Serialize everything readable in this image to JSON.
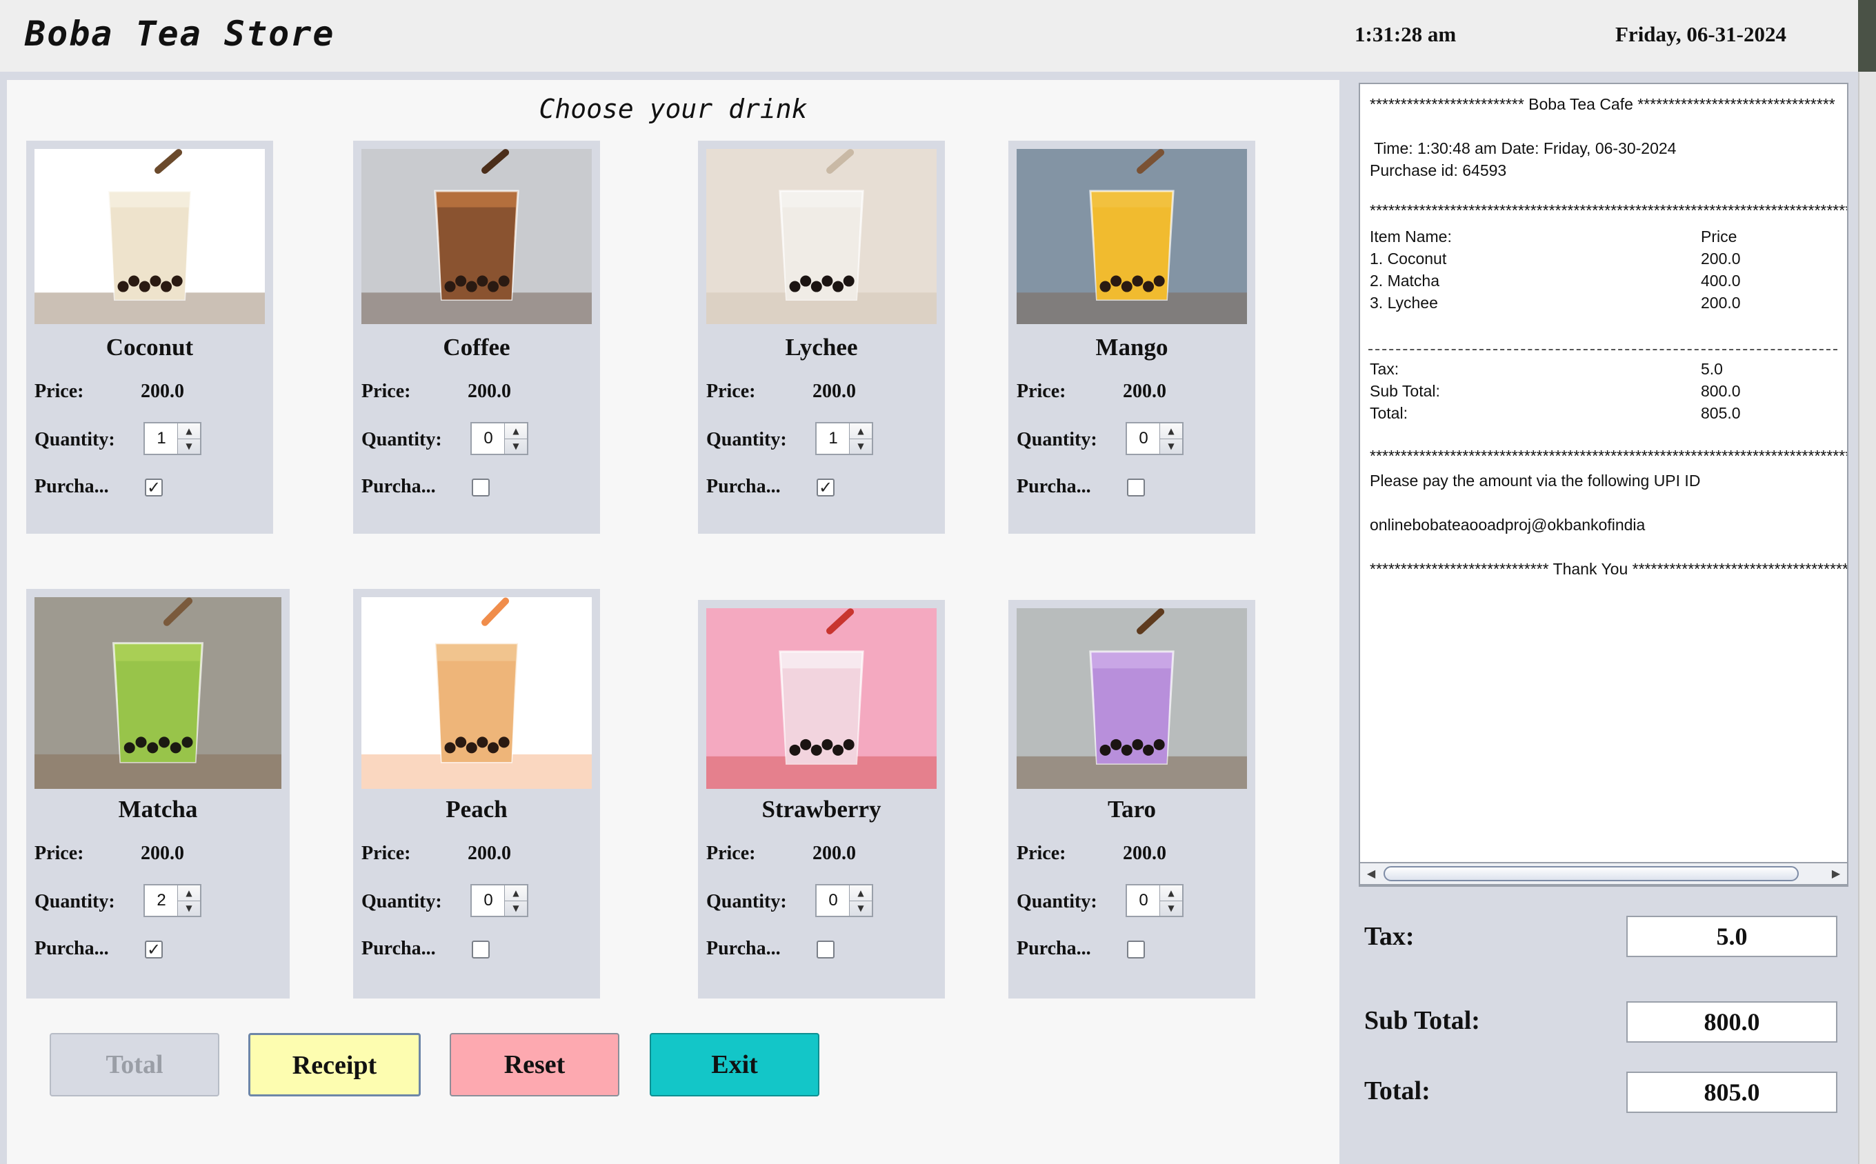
{
  "header": {
    "title": "Boba Tea Store",
    "time": "1:31:28 am",
    "date": "Friday, 06-31-2024"
  },
  "main": {
    "heading": "Choose your drink",
    "labels": {
      "price": "Price:",
      "quantity": "Quantity:",
      "purchase": "Purcha..."
    },
    "drinks": [
      {
        "name": "Coconut",
        "price": "200.0",
        "quantity": "1",
        "purchased": true,
        "photo": "coconut-bubble-tea"
      },
      {
        "name": "Coffee",
        "price": "200.0",
        "quantity": "0",
        "purchased": false,
        "photo": "coffee-bubble-tea"
      },
      {
        "name": "Lychee",
        "price": "200.0",
        "quantity": "1",
        "purchased": true,
        "photo": "lychee-bubble-tea"
      },
      {
        "name": "Mango",
        "price": "200.0",
        "quantity": "0",
        "purchased": false,
        "photo": "mango-bubble-tea"
      },
      {
        "name": "Matcha",
        "price": "200.0",
        "quantity": "2",
        "purchased": true,
        "photo": "matcha-bubble-tea"
      },
      {
        "name": "Peach",
        "price": "200.0",
        "quantity": "0",
        "purchased": false,
        "photo": "peach-bubble-tea"
      },
      {
        "name": "Strawberry",
        "price": "200.0",
        "quantity": "0",
        "purchased": false,
        "photo": "strawberry-bubble-tea"
      },
      {
        "name": "Taro",
        "price": "200.0",
        "quantity": "0",
        "purchased": false,
        "photo": "taro-bubble-tea"
      }
    ],
    "buttons": {
      "total": "Total",
      "receipt": "Receipt",
      "reset": "Reset",
      "exit": "Exit"
    }
  },
  "receipt": {
    "header_line": "************************* Boba Tea Cafe ********************************",
    "time_line": " Time: 1:30:48 am Date: Friday, 06-30-2024",
    "purchase_line": "Purchase id: 64593",
    "stars": "********************************************************************************************",
    "item_header": "Item Name:",
    "price_header": "Price",
    "items": [
      {
        "name": "1. Coconut",
        "price": "200.0"
      },
      {
        "name": "2. Matcha",
        "price": "400.0"
      },
      {
        "name": "3. Lychee",
        "price": "200.0"
      }
    ],
    "tax_label": "Tax:",
    "tax_value": "5.0",
    "subtotal_label": "Sub Total:",
    "subtotal_value": "800.0",
    "total_label": "Total:",
    "total_value": "805.0",
    "pay_line": "Please pay the amount via the following UPI ID",
    "upi_id": "onlinebobateaooadproj@okbankofindia",
    "thanks_line": "***************************** Thank You *************************************"
  },
  "summary": {
    "tax_label": "Tax:",
    "tax_value": "5.0",
    "subtotal_label": "Sub Total:",
    "subtotal_value": "800.0",
    "total_label": "Total:",
    "total_value": "805.0"
  },
  "colors": {
    "receipt_button": "#fdfdb0",
    "reset_button": "#fda9b0",
    "exit_button": "#13c6c8",
    "total_button_disabled": "#d7dae3"
  }
}
